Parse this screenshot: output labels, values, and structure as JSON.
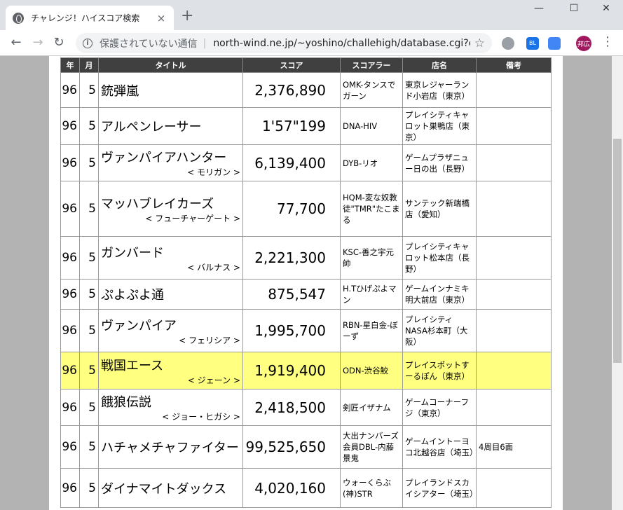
{
  "browser": {
    "tab_title": "チャレンジ！ハイスコア検索",
    "close_symbol": "×",
    "new_tab_symbol": "+",
    "security_label": "保護されていない通信",
    "url": "north-wind.ne.jp/~yoshino/challehigh/database.cgi?equal1...",
    "profile_initials": "邦広",
    "ext_label": "BL"
  },
  "table": {
    "headers": [
      "年",
      "月",
      "タイトル",
      "スコア",
      "スコアラー",
      "店名",
      "備考"
    ],
    "rows": [
      {
        "year": "96",
        "month": "5",
        "title": "銃弾嵐",
        "sub": "",
        "score": "2,376,890",
        "scorer": "OMK-タンスでガーン",
        "shop": "東京レジャーランド小岩店（東京）",
        "note": "",
        "h": 50
      },
      {
        "year": "96",
        "month": "5",
        "title": "アルペンレーサー",
        "sub": "",
        "score": "1'57\"199",
        "scorer": "DNA-HIV",
        "shop": "プレイシティキャロット巣鴨店（東京）",
        "note": "",
        "h": 53
      },
      {
        "year": "96",
        "month": "5",
        "title": "ヴァンパイアハンター",
        "sub": "< モリガン >",
        "score": "6,139,400",
        "scorer": "DYB-リオ",
        "shop": "ゲームプラザニュー日の出（長野）",
        "note": "",
        "h": 52
      },
      {
        "year": "96",
        "month": "5",
        "title": "マッハブレイカーズ",
        "sub": "< フューチャーゲート >",
        "score": "77,700",
        "scorer": "HQM-変な奴教徒\"TMR\"たこまる",
        "shop": "サンテック新端橋店（愛知）",
        "note": "",
        "h": 79
      },
      {
        "year": "96",
        "month": "5",
        "title": "ガンバード",
        "sub": "< バルナス >",
        "score": "2,221,300",
        "scorer": "KSC-善之宇元帥",
        "shop": "プレイシティキャロット松本店（長野）",
        "note": "",
        "h": 61
      },
      {
        "year": "96",
        "month": "5",
        "title": "ぷよぷよ通",
        "sub": "",
        "score": "875,547",
        "scorer": "H.Tひげぷよマン",
        "shop": "ゲームインナミキ明大前店（東京）",
        "note": "",
        "h": 43
      },
      {
        "year": "96",
        "month": "5",
        "title": "ヴァンパイア",
        "sub": "< フェリシア >",
        "score": "1,995,700",
        "scorer": "RBN-星白金-ぼーず",
        "shop": "プレイシティNASA杉本町（大阪）",
        "note": "",
        "h": 61
      },
      {
        "year": "96",
        "month": "5",
        "title": "戦国エース",
        "sub": "< ジェーン >",
        "score": "1,919,400",
        "scorer": "ODN-渋谷鮫",
        "shop": "プレイスポットすーるぽん（東京）",
        "note": "",
        "h": 53,
        "hl": true
      },
      {
        "year": "96",
        "month": "5",
        "title": "餓狼伝説",
        "sub": "< ジョー・ヒガシ >",
        "score": "2,418,500",
        "scorer": "剣匠イザナム",
        "shop": "ゲームコーナーフジ（東京）",
        "note": "",
        "h": 52
      },
      {
        "year": "96",
        "month": "5",
        "title": "ハチャメチャファイター",
        "sub": "",
        "score": "99,525,650",
        "scorer": "大出ナンバーズ会員DBL-内藤景鬼",
        "shop": "ゲームイントーヨコ北越谷店（埼玉）",
        "note": "4周目6面",
        "h": 61
      },
      {
        "year": "96",
        "month": "5",
        "title": "ダイナマイトダックス",
        "sub": "",
        "score": "4,020,160",
        "scorer": "ウォーくらぶ(神)STR",
        "shop": "プレイランドスカイシアター（埼玉）",
        "note": "",
        "h": 56
      }
    ]
  }
}
